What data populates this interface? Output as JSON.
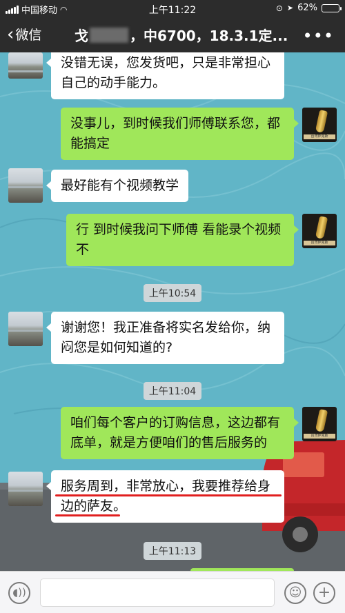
{
  "status_bar": {
    "carrier": "中国移动",
    "time": "上午11:22",
    "battery_percent": "62%",
    "battery_level": 0.62
  },
  "header": {
    "back_label": "微信",
    "title_prefix": "戈",
    "title_suffix": "，中6700，18.3.1定...",
    "more_label": "•••"
  },
  "messages": [
    {
      "side": "in",
      "text_line1": "没错无误，您发货吧，只是非常担心",
      "text_line2": "自己的动手能力。"
    },
    {
      "side": "out",
      "text_line1": "没事儿，到时候我们师傅联系您，都",
      "text_line2": "能搞定"
    },
    {
      "side": "in",
      "text_line1": "最好能有个视频教学"
    },
    {
      "side": "out",
      "text_line1": "行 到时候我问下师傅 看能录个视频",
      "text_line2": "不"
    },
    {
      "side": "time",
      "text": "上午10:54"
    },
    {
      "side": "in",
      "text_line1": "谢谢您！我正准备将实名发给你，纳",
      "text_line2": "闷您是如何知道的?"
    },
    {
      "side": "time",
      "text": "上午11:04"
    },
    {
      "side": "out",
      "text_line1": "咱们每个客户的订购信息，这边都有",
      "text_line2": "底单，就是方便咱们的售后服务的"
    },
    {
      "side": "in",
      "text_line1": "服务周到，非常放心，我要推荐给身",
      "text_line2": "边的萨友。",
      "underlined": true
    },
    {
      "side": "time",
      "text": "上午11:13"
    }
  ],
  "colors": {
    "outgoing_bubble": "#a0e75a",
    "incoming_bubble": "#ffffff",
    "header_bg": "#2c2c2c",
    "underline": "#e11f1f"
  },
  "icons": {
    "voice": "voice-icon",
    "emoji": "emoji-icon",
    "add": "add-icon"
  }
}
